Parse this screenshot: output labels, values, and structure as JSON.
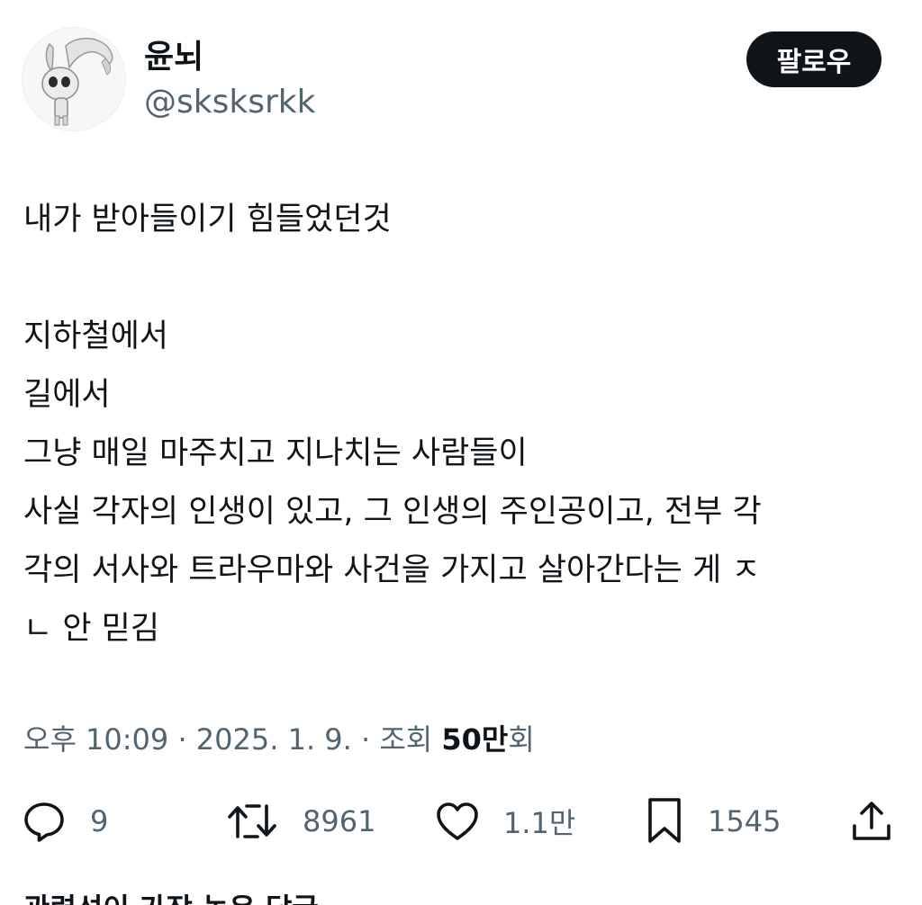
{
  "author": {
    "display_name": "윤뇌",
    "handle": "@sksksrkk",
    "avatar_icon": "bunny-character-avatar"
  },
  "follow_button": {
    "label": "팔로우"
  },
  "tweet": {
    "lines": [
      "내가 받아들이기 힘들었던것",
      "",
      "지하철에서",
      "길에서",
      "그냥 매일 마주치고 지나치는 사람들이",
      "사실 각자의 인생이 있고, 그 인생의 주인공이고, 전부 각",
      "각의 서사와 트라우마와 사건을 가지고 살아간다는 게 ㅈ",
      "ㄴ 안 믿김"
    ]
  },
  "meta": {
    "time": "오후 10:09",
    "separator": " · ",
    "date": "2025. 1. 9.",
    "views_label": "조회",
    "views_count": "50만",
    "views_suffix": "회"
  },
  "actions": {
    "reply_count": "9",
    "retweet_count": "8961",
    "like_count": "1.1만",
    "bookmark_count": "1545",
    "icons": [
      "reply-icon",
      "retweet-icon",
      "like-icon",
      "bookmark-icon",
      "share-icon"
    ]
  },
  "cutoff_text": "관련성이 가장 높은 답글",
  "colors": {
    "text_primary": "#0f1419",
    "text_secondary": "#536471",
    "follow_bg": "#0f1419"
  }
}
